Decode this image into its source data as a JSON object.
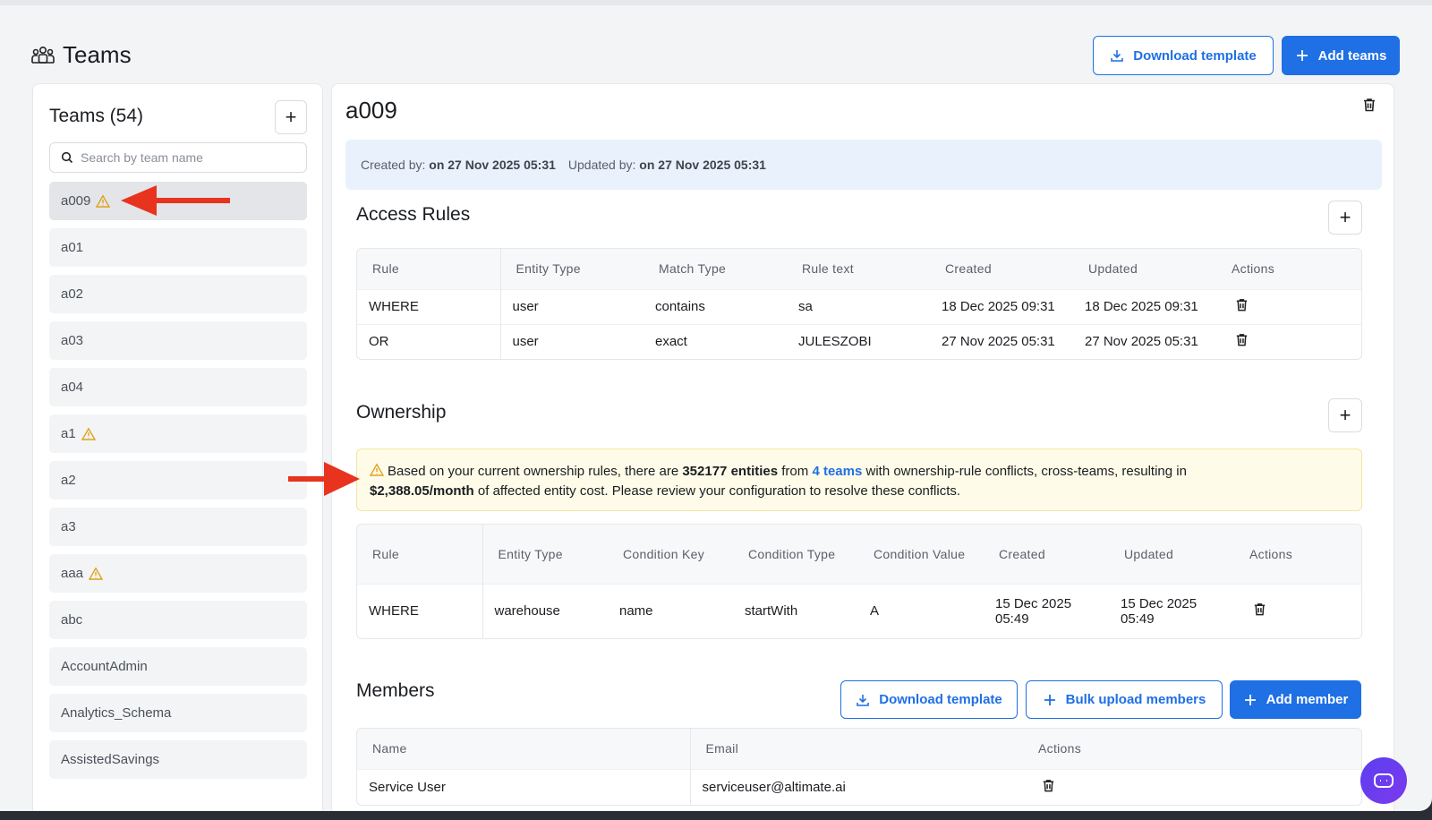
{
  "page": {
    "title": "Teams"
  },
  "header": {
    "download_template": "Download template",
    "add_teams": "Add teams"
  },
  "sidebar": {
    "title": "Teams (54)",
    "search_placeholder": "Search by team name",
    "teams": [
      {
        "name": "a009",
        "warning": true,
        "active": true
      },
      {
        "name": "a01",
        "warning": false
      },
      {
        "name": "a02",
        "warning": false
      },
      {
        "name": "a03",
        "warning": false
      },
      {
        "name": "a04",
        "warning": false
      },
      {
        "name": "a1",
        "warning": true
      },
      {
        "name": "a2",
        "warning": false
      },
      {
        "name": "a3",
        "warning": false
      },
      {
        "name": "aaa",
        "warning": true
      },
      {
        "name": "abc",
        "warning": false
      },
      {
        "name": "AccountAdmin",
        "warning": false
      },
      {
        "name": "Analytics_Schema",
        "warning": false
      },
      {
        "name": "AssistedSavings",
        "warning": false
      }
    ]
  },
  "detail": {
    "team_name": "a009",
    "created_label": "Created by:",
    "created_value": "on 27 Nov 2025 05:31",
    "updated_label": "Updated by:",
    "updated_value": "on 27 Nov 2025 05:31"
  },
  "access_rules": {
    "title": "Access Rules",
    "columns": [
      "Rule",
      "Entity Type",
      "Match Type",
      "Rule text",
      "Created",
      "Updated",
      "Actions"
    ],
    "rows": [
      {
        "rule": "WHERE",
        "entity_type": "user",
        "match_type": "contains",
        "rule_text": "sa",
        "created": "18 Dec 2025 09:31",
        "updated": "18 Dec 2025 09:31"
      },
      {
        "rule": "OR",
        "entity_type": "user",
        "match_type": "exact",
        "rule_text": "JULESZOBI",
        "created": "27 Nov 2025 05:31",
        "updated": "27 Nov 2025 05:31"
      }
    ]
  },
  "ownership": {
    "title": "Ownership",
    "alert": {
      "part1": "Based on your current ownership rules, there are ",
      "entities": "352177 entities",
      "part2": " from ",
      "teams_link": "4 teams",
      "part3": " with ownership-rule conflicts, cross-teams, resulting in",
      "cost": "$2,388.05/month",
      "part4": " of affected entity cost. Please review your configuration to resolve these conflicts."
    },
    "columns": [
      "Rule",
      "Entity Type",
      "Condition Key",
      "Condition Type",
      "Condition Value",
      "Created",
      "Updated",
      "Actions"
    ],
    "rows": [
      {
        "rule": "WHERE",
        "entity_type": "warehouse",
        "condition_key": "name",
        "condition_type": "startWith",
        "condition_value": "A",
        "created": "15 Dec 2025 05:49",
        "updated": "15 Dec 2025 05:49"
      }
    ]
  },
  "members": {
    "title": "Members",
    "download_template": "Download template",
    "bulk_upload": "Bulk upload members",
    "add_member": "Add member",
    "columns": [
      "Name",
      "Email",
      "Actions"
    ],
    "rows": [
      {
        "name": "Service User",
        "email": "serviceuser@altimate.ai"
      }
    ]
  },
  "colors": {
    "accent": "#1f6fe5",
    "warning": "#e0a21c",
    "annotation_arrow": "#e8331f"
  }
}
